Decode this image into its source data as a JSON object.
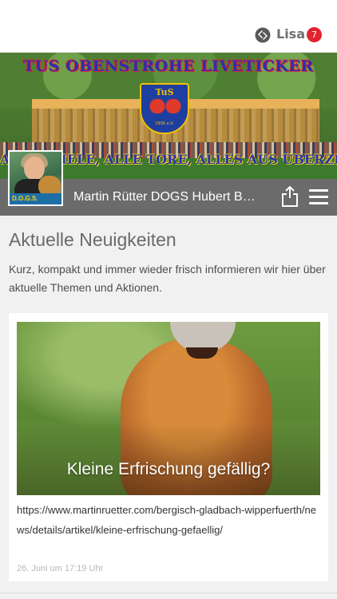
{
  "topbar": {
    "user_name": "Lisa",
    "notification_count": "7",
    "app_icon": "puzzle-logo-icon"
  },
  "banner": {
    "title": "TUS OBENSTROHE LIVETICKER",
    "crest_text": "TuS",
    "crest_year": "1936 e.V.",
    "slogan": "ALLE SPIELE, ALLE TORE, ALLES AUS ÜBERZEUGUNG"
  },
  "page": {
    "name": "Martin Rütter DOGS Hubert B…",
    "profile_logo": "D.O.G.S."
  },
  "section": {
    "title": "Aktuelle Neuigkeiten",
    "intro": "Kurz, kompakt und immer wieder frisch informieren wir hier über aktuelle Themen und Aktionen."
  },
  "news": [
    {
      "caption": "Kleine Erfrischung gefällig?",
      "link": "https://www.martinruetter.com/bergisch-gladbach-wipperfuerth/news/details/artikel/kleine-erfrischung-gefaellig/",
      "date": "26. Juni um 17:19 Uhr"
    }
  ],
  "colors": {
    "badge": "#e3232f",
    "pagebar": "#5f5f5f",
    "background": "#f1f1f1"
  }
}
